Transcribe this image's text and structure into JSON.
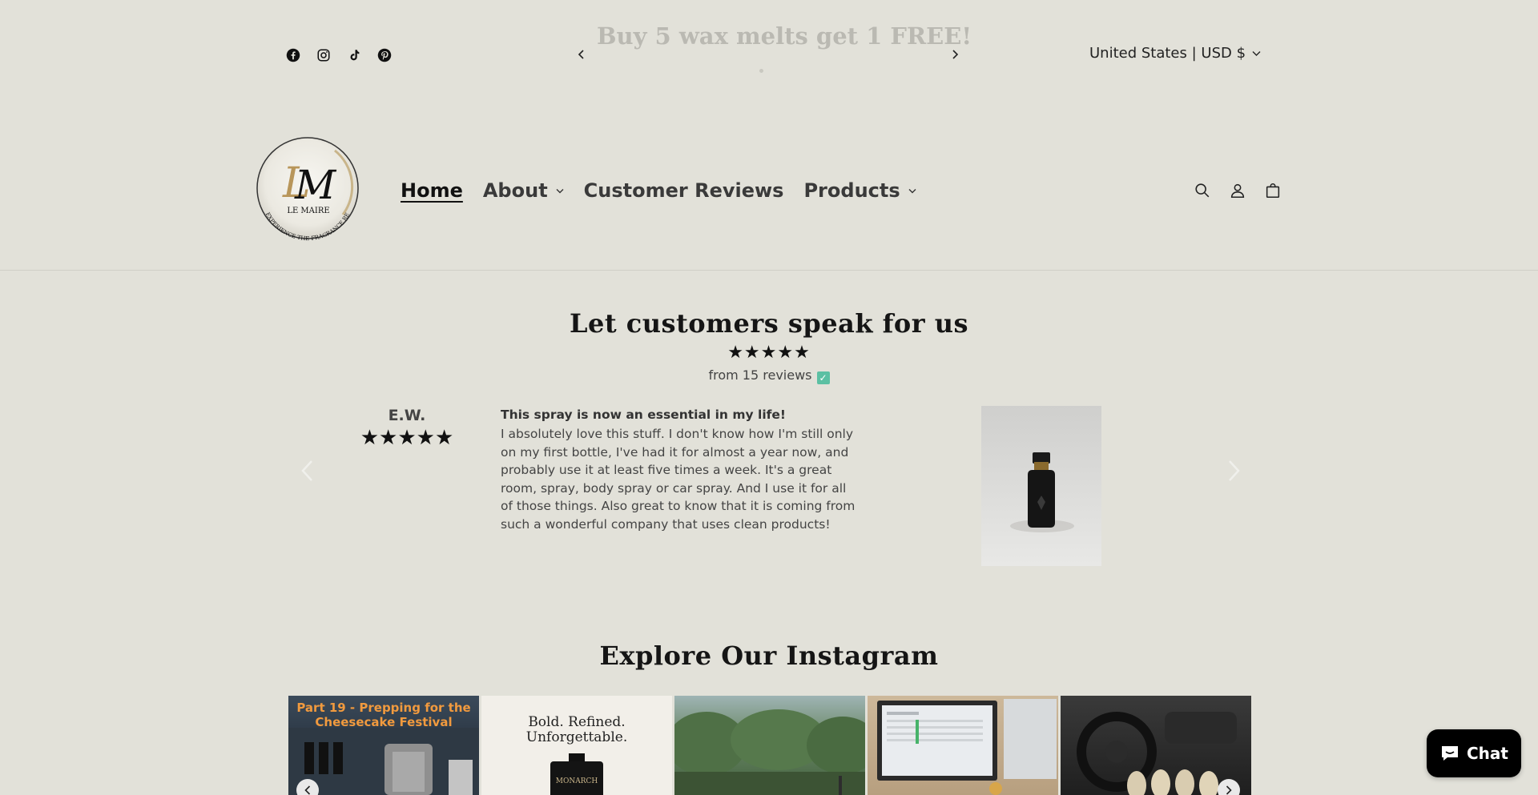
{
  "announcement": {
    "text": "Buy 5 wax melts get 1 FREE!",
    "country": "United States | USD $"
  },
  "social": [
    "facebook-icon",
    "instagram-icon",
    "tiktok-icon",
    "pinterest-icon"
  ],
  "brand": {
    "logo_initials": "LM",
    "logo_name": "LE MAIRE",
    "logo_tagline": "EXPERIENCE THE FRAGRANCE REVOLUTION",
    "accent_gold": "#b8965a"
  },
  "nav": {
    "home": "Home",
    "about": "About",
    "reviews": "Customer Reviews",
    "products": "Products"
  },
  "header_icons": [
    "search-icon",
    "account-icon",
    "cart-icon"
  ],
  "reviews": {
    "title": "Let customers speak for us",
    "stars": "★★★★★",
    "count": "from 15 reviews",
    "check": "✓",
    "author": "E.W.",
    "author_stars": "★★★★★",
    "review_title": "This spray is now an essential in my life!",
    "review_body": "I absolutely love this stuff. I don't know how I'm still only on my first bottle, I've had it for almost a year now, and probably use it at least five times a week. It's a great room, spray, body spray or car spray. And I use it for all of those things. Also great to know that it is coming from such a wonderful company that uses clean products!"
  },
  "instagram": {
    "title": "Explore Our Instagram",
    "tile1_caption": "Part 19 - Prepping for the Cheesecake Festival",
    "tile2_line1": "Bold. Refined.",
    "tile2_line2": "Unforgettable.",
    "tile2_brand": "MONARCH"
  },
  "chat": {
    "label": "Chat"
  }
}
